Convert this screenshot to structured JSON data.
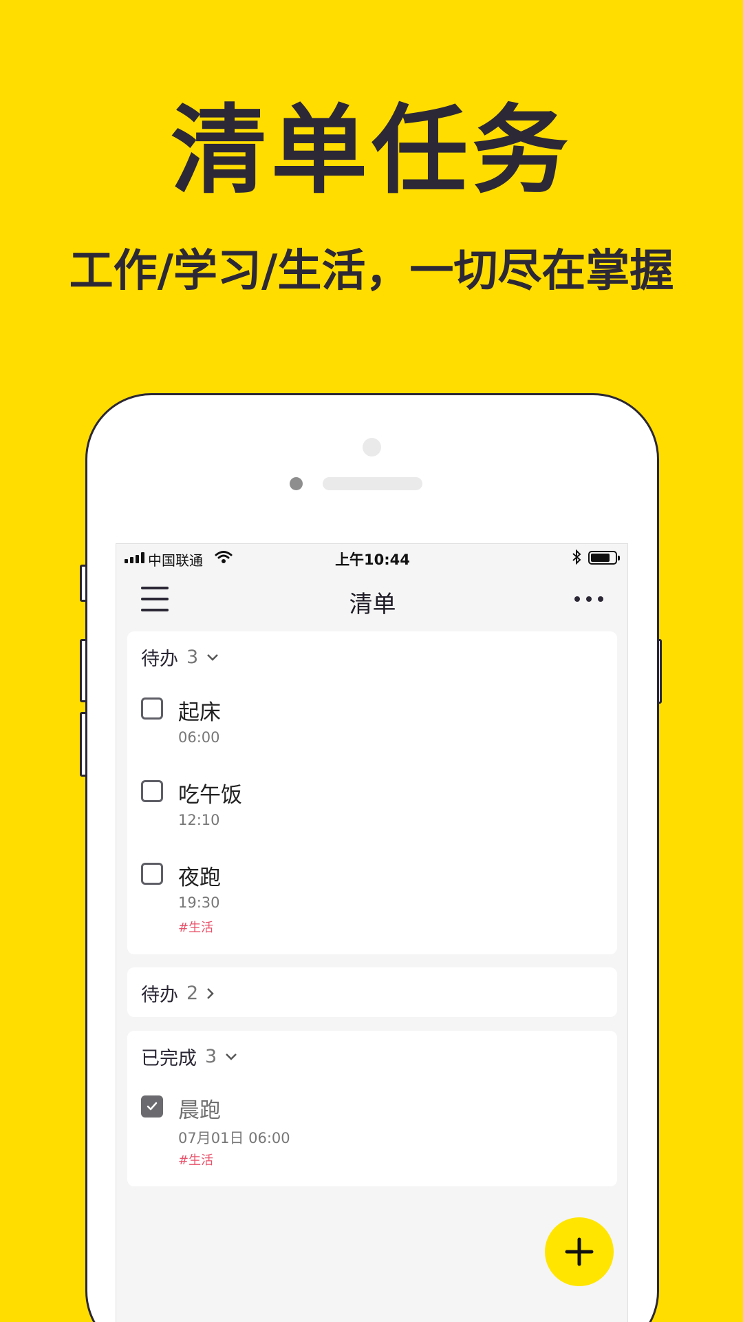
{
  "headline": "清单任务",
  "subheadline": "工作/学习/生活，一切尽在掌握",
  "status_bar": {
    "carrier": "中国联通",
    "time": "上午10:44",
    "signal_icon": "signal-bars-icon",
    "wifi_icon": "wifi-icon",
    "bluetooth_icon": "bluetooth-icon",
    "battery_level": 0.8
  },
  "nav": {
    "title": "清单",
    "menu_icon": "hamburger-menu-icon",
    "more_icon": "more-dots-icon"
  },
  "sections": [
    {
      "label": "待办",
      "count": "3",
      "expanded": true,
      "tasks": [
        {
          "title": "起床",
          "time": "06:00",
          "tag": "",
          "done": false
        },
        {
          "title": "吃午饭",
          "time": "12:10",
          "tag": "",
          "done": false
        },
        {
          "title": "夜跑",
          "time": "19:30",
          "tag": "#生活",
          "done": false
        }
      ]
    },
    {
      "label": "待办",
      "count": "2",
      "expanded": false,
      "tasks": []
    },
    {
      "label": "已完成",
      "count": "3",
      "expanded": true,
      "tasks": [
        {
          "title": "晨跑",
          "time": "07月01日 06:00",
          "tag": "#生活",
          "done": true
        }
      ]
    }
  ],
  "fab_icon": "plus-icon",
  "colors": {
    "background": "#FFDD00",
    "fab": "#FFE500",
    "text_dark": "#2D2836",
    "tag": "#E8526A"
  }
}
